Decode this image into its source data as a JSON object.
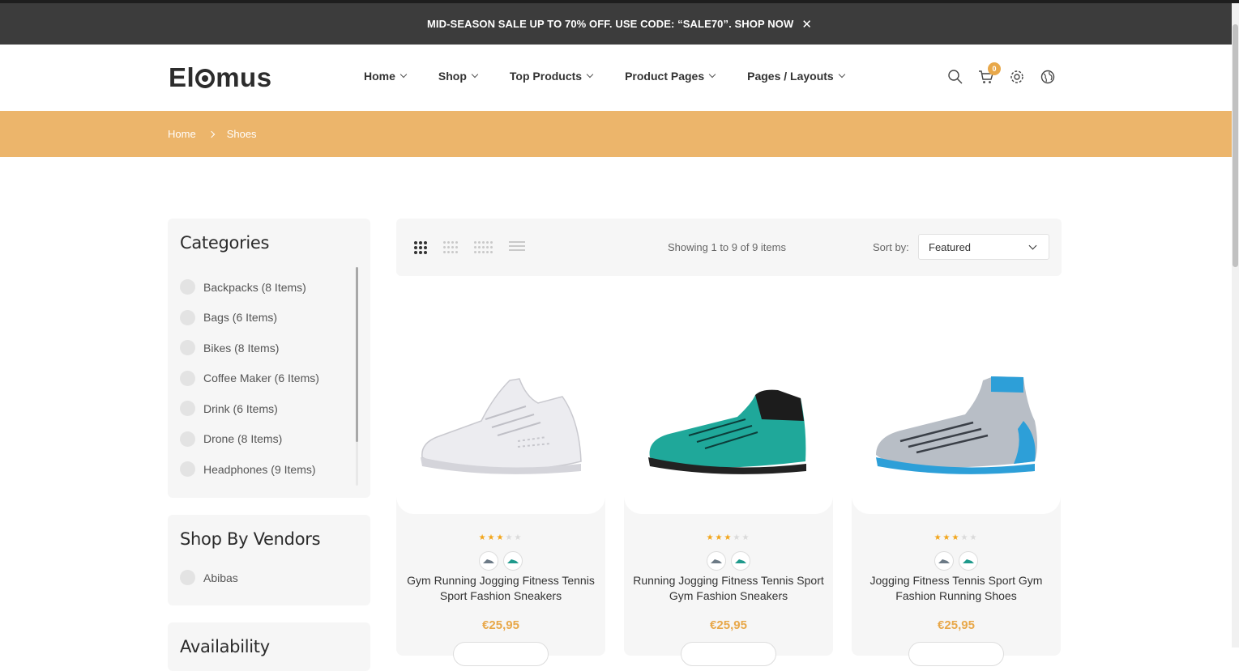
{
  "announcement": {
    "text": "MID-SEASON SALE UP TO 70% OFF. USE CODE: “SALE70”. SHOP NOW",
    "close": "✕"
  },
  "header": {
    "logo": {
      "pre": "El",
      "post": "mus"
    },
    "nav": [
      {
        "label": "Home"
      },
      {
        "label": "Shop"
      },
      {
        "label": "Top Products"
      },
      {
        "label": "Product Pages"
      },
      {
        "label": "Pages / Layouts"
      }
    ],
    "cart_count": "0"
  },
  "breadcrumb": {
    "home": "Home",
    "current": "Shoes"
  },
  "sidebar": {
    "categories": {
      "title": "Categories",
      "items": [
        {
          "label": "Backpacks (8 Items)"
        },
        {
          "label": "Bags (6 Items)"
        },
        {
          "label": "Bikes (8 Items)"
        },
        {
          "label": "Coffee Maker (6 Items)"
        },
        {
          "label": "Drink (6 Items)"
        },
        {
          "label": "Drone (8 Items)"
        },
        {
          "label": "Headphones (9 Items)"
        }
      ]
    },
    "vendors": {
      "title": "Shop By Vendors",
      "items": [
        {
          "label": "Abibas"
        }
      ]
    },
    "availability": {
      "title": "Availability"
    }
  },
  "toolbar": {
    "showing": "Showing 1 to 9 of 9 items",
    "sort_label": "Sort by:",
    "sort_value": "Featured"
  },
  "products": [
    {
      "title": "Gym Running Jogging Fitness Tennis Sport Fashion Sneakers",
      "price": "€25,95",
      "rating": 3,
      "rating_max": 5,
      "color": "#e8e8ec"
    },
    {
      "title": "Running Jogging Fitness Tennis Sport Gym Fashion Sneakers",
      "price": "€25,95",
      "rating": 3,
      "rating_max": 5,
      "color": "#1fa89a"
    },
    {
      "title": "Jogging Fitness Tennis Sport Gym Fashion Running Shoes",
      "price": "€25,95",
      "rating": 3,
      "rating_max": 5,
      "color": "#2d9fd8"
    }
  ],
  "colors": {
    "accent": "#e8a84a",
    "breadcrumb_bg": "#ecb56b",
    "topbar": "#3c3c3c"
  }
}
